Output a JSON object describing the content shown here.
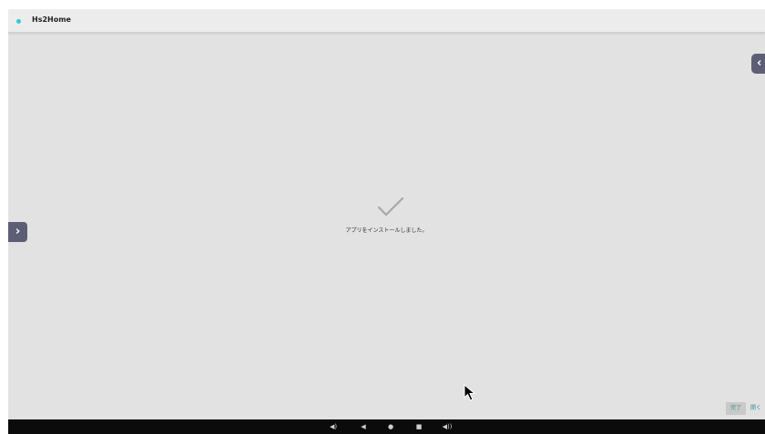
{
  "window": {
    "title": "Hs2Home"
  },
  "side_buttons": {
    "right_glyph": "‹",
    "left_glyph": "›"
  },
  "installer": {
    "message": "アプリをインストールしました。",
    "done_label": "完了",
    "open_label": "開く"
  },
  "navbar": {
    "items": [
      {
        "name": "volume-down-icon",
        "glyph": "◀)"
      },
      {
        "name": "back-icon",
        "glyph": "◀"
      },
      {
        "name": "home-icon",
        "glyph": "●"
      },
      {
        "name": "recents-icon",
        "glyph": "■"
      },
      {
        "name": "volume-up-icon",
        "glyph": "◀))"
      }
    ]
  },
  "colors": {
    "accent": "#35c8d6",
    "side_button": "#5d5e76",
    "action_text": "#2d8f8a",
    "check": "#a8a8a8"
  }
}
